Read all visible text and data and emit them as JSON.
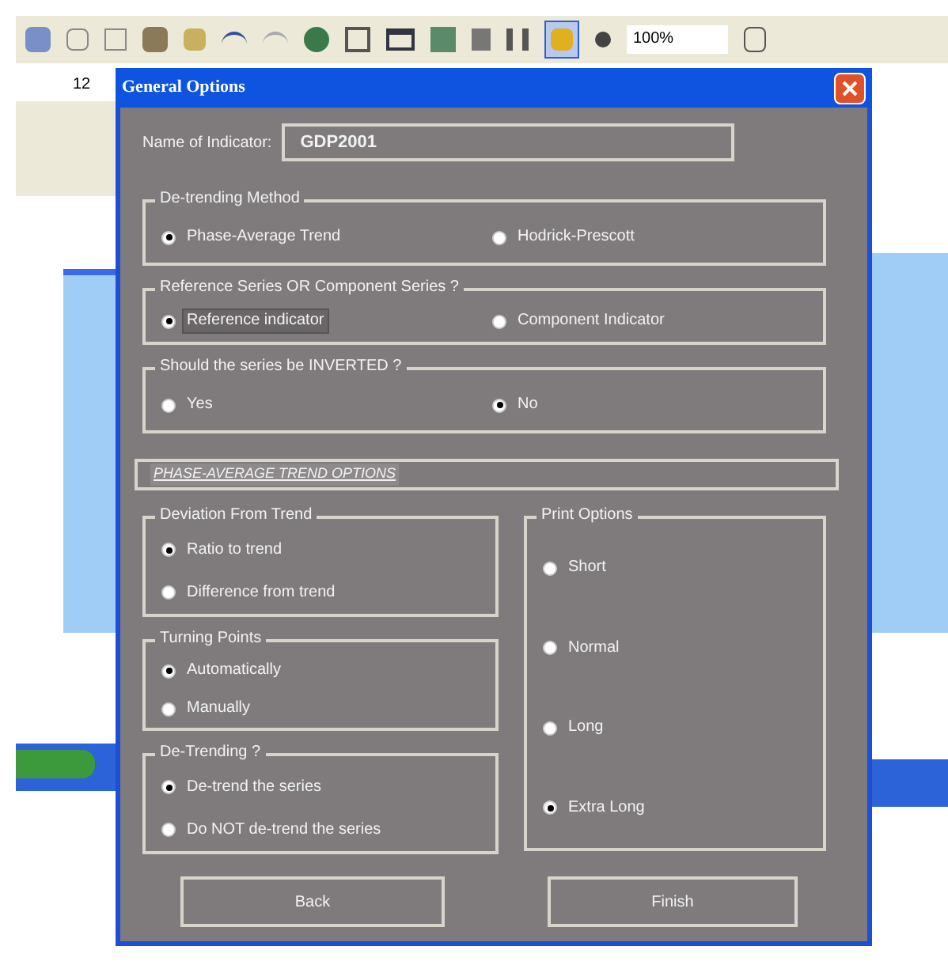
{
  "toolbar": {
    "zoom": "100%",
    "font_size": "12"
  },
  "dialog": {
    "title": "General Options",
    "name_label": "Name of Indicator:",
    "name_value": "GDP2001",
    "top_groups": [
      {
        "title": "De-trending Method",
        "options": [
          {
            "label": "Phase-Average Trend",
            "selected": true,
            "focused": false
          },
          {
            "label": "Hodrick-Prescott",
            "selected": false,
            "focused": false
          }
        ]
      },
      {
        "title": "Reference Series OR Component Series ?",
        "options": [
          {
            "label": "Reference indicator",
            "selected": true,
            "focused": true
          },
          {
            "label": "Component Indicator",
            "selected": false,
            "focused": false
          }
        ]
      },
      {
        "title": "Should the series be INVERTED ?",
        "options": [
          {
            "label": "Yes",
            "selected": false,
            "focused": false
          },
          {
            "label": "No",
            "selected": true,
            "focused": false
          }
        ]
      }
    ],
    "section_header": "PHASE-AVERAGE TREND OPTIONS",
    "left_groups": [
      {
        "title": "Deviation From Trend",
        "options": [
          {
            "label": "Ratio to trend",
            "selected": true,
            "focused": false
          },
          {
            "label": "Difference from trend",
            "selected": false,
            "focused": false
          }
        ]
      },
      {
        "title": "Turning Points",
        "options": [
          {
            "label": "Automatically",
            "selected": true,
            "focused": false
          },
          {
            "label": "Manually",
            "selected": false,
            "focused": false
          }
        ]
      },
      {
        "title": "De-Trending ?",
        "options": [
          {
            "label": "De-trend the series",
            "selected": true,
            "focused": false
          },
          {
            "label": "Do NOT de-trend the series",
            "selected": false,
            "focused": false
          }
        ]
      }
    ],
    "print_options": {
      "title": "Print Options",
      "options": [
        {
          "label": "Short",
          "selected": false,
          "focused": false
        },
        {
          "label": "Normal",
          "selected": false,
          "focused": false
        },
        {
          "label": "Long",
          "selected": false,
          "focused": false
        },
        {
          "label": "Extra Long",
          "selected": true,
          "focused": false
        }
      ]
    },
    "buttons": [
      "Back",
      "Finish"
    ]
  }
}
